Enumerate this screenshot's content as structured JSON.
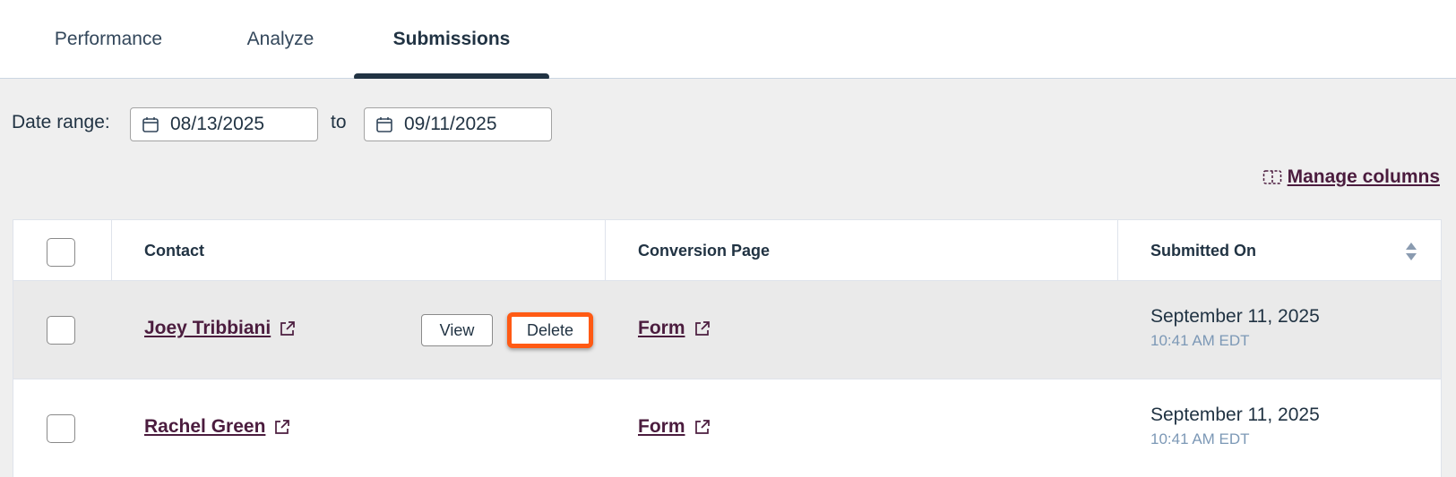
{
  "tabs": [
    {
      "label": "Performance",
      "active": false
    },
    {
      "label": "Analyze",
      "active": false
    },
    {
      "label": "Submissions",
      "active": true
    }
  ],
  "filters": {
    "date_range_label": "Date range:",
    "start_date": "08/13/2025",
    "to_label": "to",
    "end_date": "09/11/2025"
  },
  "manage_columns": {
    "label": "Manage columns",
    "icon": "columns-icon"
  },
  "table": {
    "headers": [
      "Contact",
      "Conversion Page",
      "Submitted On"
    ],
    "rows": [
      {
        "contact": "Joey Tribbiani",
        "conversion_page": "Form",
        "date": "September 11, 2025",
        "time": "10:41 AM EDT",
        "hovered": true,
        "actions": {
          "view": "View",
          "delete": "Delete"
        }
      },
      {
        "contact": "Rachel Green",
        "conversion_page": "Form",
        "date": "September 11, 2025",
        "time": "10:41 AM EDT",
        "hovered": false
      }
    ]
  },
  "colors": {
    "link": "#4b1c3e",
    "highlight": "#ff5a14",
    "text_dark": "#213343",
    "row_hover": "#eaeaea",
    "page_bg": "#efefef"
  }
}
